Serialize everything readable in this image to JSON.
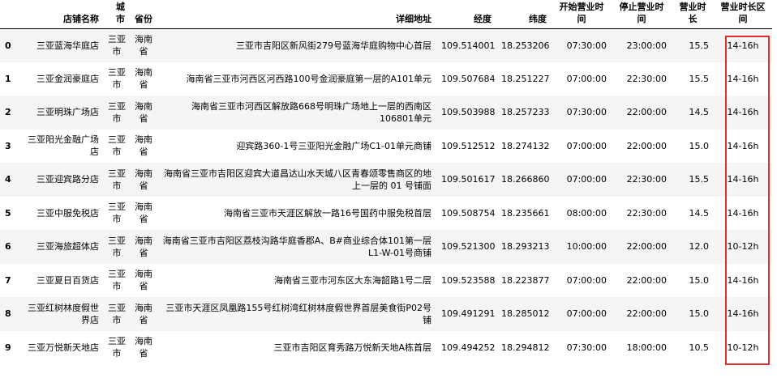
{
  "table": {
    "columns": {
      "index": "",
      "store": "店铺名称",
      "city": "城市",
      "province": "省份",
      "address": "详细地址",
      "lng": "经度",
      "lat": "纬度",
      "open": "开始营业时间",
      "close": "停止营业时间",
      "hours": "营业时长",
      "span": "营业时长区间"
    },
    "rows": [
      {
        "index": "0",
        "store": "三亚蓝海华庭店",
        "city": "三亚市",
        "province": "海南省",
        "address": "三亚市吉阳区新风街279号蓝海华庭购物中心首层",
        "lng": "109.514001",
        "lat": "18.253206",
        "open": "07:30:00",
        "close": "23:00:00",
        "hours": "15.5",
        "span": "14-16h"
      },
      {
        "index": "1",
        "store": "三亚金润豪庭店",
        "city": "三亚市",
        "province": "海南省",
        "address": "海南省三亚市河西区河西路100号金润豪庭第一层的A101单元",
        "lng": "109.507684",
        "lat": "18.251227",
        "open": "07:00:00",
        "close": "22:30:00",
        "hours": "15.5",
        "span": "14-16h"
      },
      {
        "index": "2",
        "store": "三亚明珠广场店",
        "city": "三亚市",
        "province": "海南省",
        "address": "海南省三亚市河西区解放路668号明珠广场地上一层的西南区106801单元",
        "lng": "109.503988",
        "lat": "18.257233",
        "open": "07:30:00",
        "close": "22:00:00",
        "hours": "14.5",
        "span": "14-16h"
      },
      {
        "index": "3",
        "store": "三亚阳光金融广场店",
        "city": "三亚市",
        "province": "海南省",
        "address": "迎宾路360-1号三亚阳光金融广场C1-01单元商铺",
        "lng": "109.512512",
        "lat": "18.274132",
        "open": "07:00:00",
        "close": "22:00:00",
        "hours": "15.0",
        "span": "14-16h"
      },
      {
        "index": "4",
        "store": "三亚迎宾路分店",
        "city": "三亚市",
        "province": "海南省",
        "address": "海南省三亚市吉阳区迎宾大道昌达山水天城八区青春颂零售商区的地上一层的 01 号铺面",
        "lng": "109.501617",
        "lat": "18.266860",
        "open": "07:00:00",
        "close": "22:30:00",
        "hours": "15.5",
        "span": "14-16h"
      },
      {
        "index": "5",
        "store": "三亚中服免税店",
        "city": "三亚市",
        "province": "海南省",
        "address": "海南省三亚市天涯区解放一路16号国药中服免税首层",
        "lng": "109.508754",
        "lat": "18.235661",
        "open": "08:00:00",
        "close": "22:30:00",
        "hours": "14.5",
        "span": "14-16h"
      },
      {
        "index": "6",
        "store": "三亚海旅超体店",
        "city": "三亚市",
        "province": "海南省",
        "address": "海南省三亚市吉阳区荔枝沟路华庭香郡A、B#商业综合体101第一层L1-W-01号商铺",
        "lng": "109.521300",
        "lat": "18.293213",
        "open": "10:00:00",
        "close": "22:00:00",
        "hours": "12.0",
        "span": "10-12h"
      },
      {
        "index": "7",
        "store": "三亚夏日百货店",
        "city": "三亚市",
        "province": "海南省",
        "address": "海南省三亚市河东区大东海韶路1号二层",
        "lng": "109.523588",
        "lat": "18.223877",
        "open": "07:00:00",
        "close": "22:00:00",
        "hours": "15.0",
        "span": "14-16h"
      },
      {
        "index": "8",
        "store": "三亚红树林度假世界店",
        "city": "三亚市",
        "province": "海南省",
        "address": "三亚市天涯区凤凰路155号红树湾红树林度假世界首层美食街P02号铺",
        "lng": "109.491291",
        "lat": "18.285012",
        "open": "07:00:00",
        "close": "22:00:00",
        "hours": "15.0",
        "span": "14-16h"
      },
      {
        "index": "9",
        "store": "三亚万悦新天地店",
        "city": "三亚市",
        "province": "海南省",
        "address": "三亚市吉阳区育秀路万悦新天地A栋首层",
        "lng": "109.494252",
        "lat": "18.294812",
        "open": "07:30:00",
        "close": "18:00:00",
        "hours": "10.5",
        "span": "10-12h"
      }
    ]
  },
  "highlight": {
    "color": "#e03030",
    "column": "营业时长区间"
  }
}
